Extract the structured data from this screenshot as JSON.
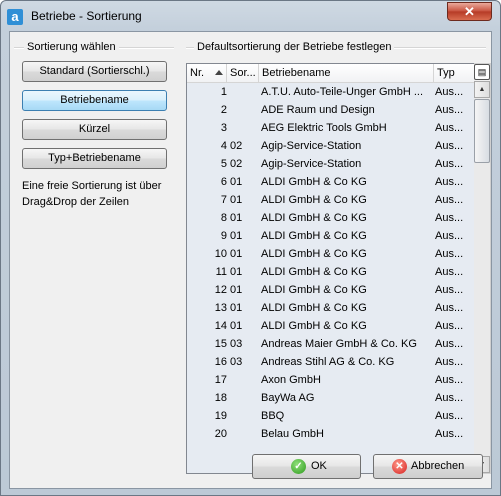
{
  "window": {
    "title": "Betriebe - Sortierung",
    "app_icon_letter": "a",
    "close_glyph": "✕"
  },
  "left_panel": {
    "title": "Sortierung wählen",
    "buttons": [
      {
        "label": "Standard (Sortierschl.)",
        "active": false
      },
      {
        "label": "Betriebename",
        "active": true
      },
      {
        "label": "Kürzel",
        "active": false
      },
      {
        "label": "Typ+Betriebename",
        "active": false
      }
    ],
    "hint": "Eine freie Sortierung ist über Drag&Drop der Zeilen"
  },
  "right_panel": {
    "title": "Defaultsortierung der Betriebe festlegen",
    "columns": {
      "nr": "Nr.",
      "sor": "Sor...",
      "name": "Betriebename",
      "typ": "Typ"
    },
    "column_chooser_icon": "column-chooser-icon",
    "rows": [
      {
        "nr": "1",
        "sor": "",
        "name": "A.T.U. Auto-Teile-Unger GmbH ...",
        "typ": "Aus..."
      },
      {
        "nr": "2",
        "sor": "",
        "name": "ADE Raum und Design",
        "typ": "Aus..."
      },
      {
        "nr": "3",
        "sor": "",
        "name": "AEG Elektric Tools GmbH",
        "typ": "Aus..."
      },
      {
        "nr": "4",
        "sor": "02",
        "name": "Agip-Service-Station",
        "typ": "Aus..."
      },
      {
        "nr": "5",
        "sor": "02",
        "name": "Agip-Service-Station",
        "typ": "Aus..."
      },
      {
        "nr": "6",
        "sor": "01",
        "name": "ALDI GmbH & Co KG",
        "typ": "Aus..."
      },
      {
        "nr": "7",
        "sor": "01",
        "name": "ALDI GmbH & Co KG",
        "typ": "Aus..."
      },
      {
        "nr": "8",
        "sor": "01",
        "name": "ALDI GmbH & Co KG",
        "typ": "Aus..."
      },
      {
        "nr": "9",
        "sor": "01",
        "name": "ALDI GmbH & Co KG",
        "typ": "Aus..."
      },
      {
        "nr": "10",
        "sor": "01",
        "name": "ALDI GmbH & Co KG",
        "typ": "Aus..."
      },
      {
        "nr": "11",
        "sor": "01",
        "name": "ALDI GmbH & Co KG",
        "typ": "Aus..."
      },
      {
        "nr": "12",
        "sor": "01",
        "name": "ALDI GmbH & Co KG",
        "typ": "Aus..."
      },
      {
        "nr": "13",
        "sor": "01",
        "name": "ALDI GmbH & Co KG",
        "typ": "Aus..."
      },
      {
        "nr": "14",
        "sor": "01",
        "name": "ALDI GmbH & Co KG",
        "typ": "Aus..."
      },
      {
        "nr": "15",
        "sor": "03",
        "name": "Andreas Maier GmbH & Co. KG",
        "typ": "Aus..."
      },
      {
        "nr": "16",
        "sor": "03",
        "name": "Andreas Stihl AG & Co. KG",
        "typ": "Aus..."
      },
      {
        "nr": "17",
        "sor": "",
        "name": "Axon GmbH",
        "typ": "Aus..."
      },
      {
        "nr": "18",
        "sor": "",
        "name": "BayWa AG",
        "typ": "Aus..."
      },
      {
        "nr": "19",
        "sor": "",
        "name": "BBQ",
        "typ": "Aus..."
      },
      {
        "nr": "20",
        "sor": "",
        "name": "Belau GmbH",
        "typ": "Aus..."
      }
    ]
  },
  "footer": {
    "ok_label": "OK",
    "cancel_label": "Abbrechen",
    "ok_glyph": "✓",
    "cancel_glyph": "✕"
  },
  "colors": {
    "accent_button": "#bee6fd",
    "grid_background": "#e6ebf2",
    "dialog_background": "#f0f0f0"
  }
}
